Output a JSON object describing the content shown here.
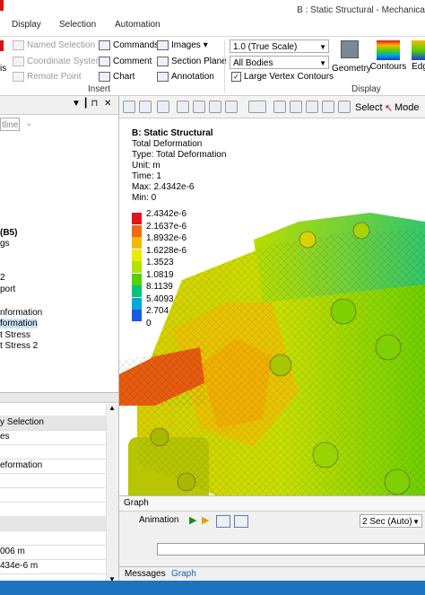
{
  "window": {
    "title": "B : Static Structural - Mechanica"
  },
  "ribbon_tabs": [
    "Display",
    "Selection",
    "Automation"
  ],
  "ribbon": {
    "left_cut_label": "is",
    "insert_items": [
      "Named Selection",
      "Coordinate System",
      "Remote Point"
    ],
    "insert_items2": [
      "Commands",
      "Comment",
      "Chart"
    ],
    "insert_items3": [
      "Images",
      "Section Plane",
      "Annotation"
    ],
    "insert_group": "Insert",
    "scale_combo": "1.0 (True Scale)",
    "bodies_combo": "All Bodies",
    "vertex_checkbox": "Large Vertex Contours",
    "display_buttons": [
      "Geometry",
      "Contours",
      "Edg"
    ],
    "display_group": "Display"
  },
  "left_panel": {
    "outline_placeholder": "tline",
    "tree_items": [
      "(B5)",
      "gs",
      "2",
      "port",
      "nformation",
      "formation",
      "t Stress",
      "t Stress 2"
    ],
    "selected_index": 5,
    "details_rows": [
      "y Selection",
      "es",
      "",
      "eformation",
      "",
      "",
      "",
      "",
      "",
      "",
      "",
      "",
      "006 m",
      "434e-6 m"
    ]
  },
  "viewport": {
    "toolbar_select": "Select",
    "toolbar_mode": "Mode",
    "info": {
      "title": "B: Static Structural",
      "lines": [
        "Total Deformation",
        "Type: Total Deformation",
        "Unit: m",
        "Time: 1",
        "Max: 2.4342e-6",
        "Min: 0"
      ]
    },
    "legend": {
      "labels": [
        "2.4342e-6",
        "2.1637e-6",
        "1.8932e-6",
        "1.6228e-6",
        "1.3523",
        "1.0819",
        "8.1139",
        "5.4093",
        "2.704",
        "0"
      ],
      "colors": [
        "#e0141c",
        "#f06a12",
        "#f5b800",
        "#eaea00",
        "#b5e000",
        "#55d100",
        "#00c57a",
        "#00a8d8",
        "#1a5ae0",
        "#0a1fb0"
      ]
    }
  },
  "graph": {
    "header": "Graph",
    "animation_label": "Animation",
    "animation_speed": "2 Sec (Auto)",
    "tabs": [
      "Messages",
      "Graph"
    ]
  }
}
